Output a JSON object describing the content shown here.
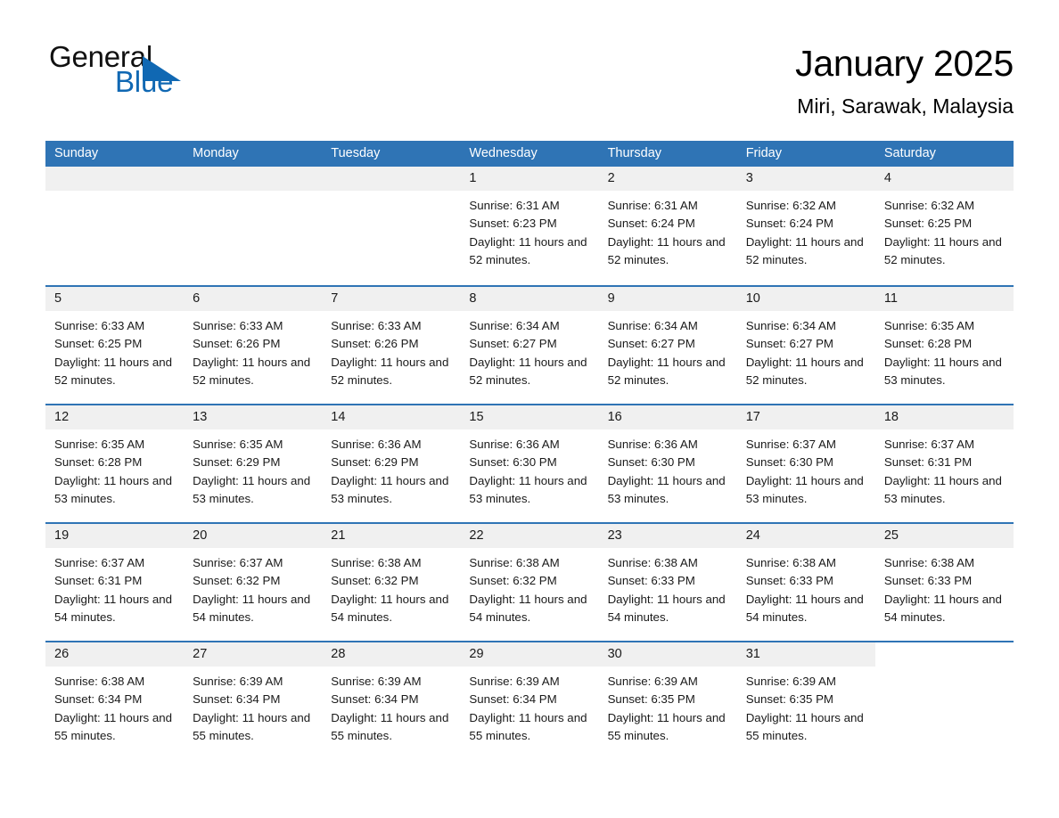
{
  "brand": {
    "word_one": "General",
    "word_two": "Blue",
    "triangle_color": "#1068b3"
  },
  "header": {
    "month_title": "January 2025",
    "location": "Miri, Sarawak, Malaysia"
  },
  "theme": {
    "header_blue": "#2f74b5",
    "day_band_gray": "#f0f0f0",
    "text_dark": "#1a1a1a",
    "header_text": "#ffffff"
  },
  "weekdays": [
    "Sunday",
    "Monday",
    "Tuesday",
    "Wednesday",
    "Thursday",
    "Friday",
    "Saturday"
  ],
  "weeks": [
    [
      {
        "day": "",
        "empty": true
      },
      {
        "day": "",
        "empty": true
      },
      {
        "day": "",
        "empty": true
      },
      {
        "day": "1",
        "sunrise": "Sunrise: 6:31 AM",
        "sunset": "Sunset: 6:23 PM",
        "daylight": "Daylight: 11 hours and 52 minutes."
      },
      {
        "day": "2",
        "sunrise": "Sunrise: 6:31 AM",
        "sunset": "Sunset: 6:24 PM",
        "daylight": "Daylight: 11 hours and 52 minutes."
      },
      {
        "day": "3",
        "sunrise": "Sunrise: 6:32 AM",
        "sunset": "Sunset: 6:24 PM",
        "daylight": "Daylight: 11 hours and 52 minutes."
      },
      {
        "day": "4",
        "sunrise": "Sunrise: 6:32 AM",
        "sunset": "Sunset: 6:25 PM",
        "daylight": "Daylight: 11 hours and 52 minutes."
      }
    ],
    [
      {
        "day": "5",
        "sunrise": "Sunrise: 6:33 AM",
        "sunset": "Sunset: 6:25 PM",
        "daylight": "Daylight: 11 hours and 52 minutes."
      },
      {
        "day": "6",
        "sunrise": "Sunrise: 6:33 AM",
        "sunset": "Sunset: 6:26 PM",
        "daylight": "Daylight: 11 hours and 52 minutes."
      },
      {
        "day": "7",
        "sunrise": "Sunrise: 6:33 AM",
        "sunset": "Sunset: 6:26 PM",
        "daylight": "Daylight: 11 hours and 52 minutes."
      },
      {
        "day": "8",
        "sunrise": "Sunrise: 6:34 AM",
        "sunset": "Sunset: 6:27 PM",
        "daylight": "Daylight: 11 hours and 52 minutes."
      },
      {
        "day": "9",
        "sunrise": "Sunrise: 6:34 AM",
        "sunset": "Sunset: 6:27 PM",
        "daylight": "Daylight: 11 hours and 52 minutes."
      },
      {
        "day": "10",
        "sunrise": "Sunrise: 6:34 AM",
        "sunset": "Sunset: 6:27 PM",
        "daylight": "Daylight: 11 hours and 52 minutes."
      },
      {
        "day": "11",
        "sunrise": "Sunrise: 6:35 AM",
        "sunset": "Sunset: 6:28 PM",
        "daylight": "Daylight: 11 hours and 53 minutes."
      }
    ],
    [
      {
        "day": "12",
        "sunrise": "Sunrise: 6:35 AM",
        "sunset": "Sunset: 6:28 PM",
        "daylight": "Daylight: 11 hours and 53 minutes."
      },
      {
        "day": "13",
        "sunrise": "Sunrise: 6:35 AM",
        "sunset": "Sunset: 6:29 PM",
        "daylight": "Daylight: 11 hours and 53 minutes."
      },
      {
        "day": "14",
        "sunrise": "Sunrise: 6:36 AM",
        "sunset": "Sunset: 6:29 PM",
        "daylight": "Daylight: 11 hours and 53 minutes."
      },
      {
        "day": "15",
        "sunrise": "Sunrise: 6:36 AM",
        "sunset": "Sunset: 6:30 PM",
        "daylight": "Daylight: 11 hours and 53 minutes."
      },
      {
        "day": "16",
        "sunrise": "Sunrise: 6:36 AM",
        "sunset": "Sunset: 6:30 PM",
        "daylight": "Daylight: 11 hours and 53 minutes."
      },
      {
        "day": "17",
        "sunrise": "Sunrise: 6:37 AM",
        "sunset": "Sunset: 6:30 PM",
        "daylight": "Daylight: 11 hours and 53 minutes."
      },
      {
        "day": "18",
        "sunrise": "Sunrise: 6:37 AM",
        "sunset": "Sunset: 6:31 PM",
        "daylight": "Daylight: 11 hours and 53 minutes."
      }
    ],
    [
      {
        "day": "19",
        "sunrise": "Sunrise: 6:37 AM",
        "sunset": "Sunset: 6:31 PM",
        "daylight": "Daylight: 11 hours and 54 minutes."
      },
      {
        "day": "20",
        "sunrise": "Sunrise: 6:37 AM",
        "sunset": "Sunset: 6:32 PM",
        "daylight": "Daylight: 11 hours and 54 minutes."
      },
      {
        "day": "21",
        "sunrise": "Sunrise: 6:38 AM",
        "sunset": "Sunset: 6:32 PM",
        "daylight": "Daylight: 11 hours and 54 minutes."
      },
      {
        "day": "22",
        "sunrise": "Sunrise: 6:38 AM",
        "sunset": "Sunset: 6:32 PM",
        "daylight": "Daylight: 11 hours and 54 minutes."
      },
      {
        "day": "23",
        "sunrise": "Sunrise: 6:38 AM",
        "sunset": "Sunset: 6:33 PM",
        "daylight": "Daylight: 11 hours and 54 minutes."
      },
      {
        "day": "24",
        "sunrise": "Sunrise: 6:38 AM",
        "sunset": "Sunset: 6:33 PM",
        "daylight": "Daylight: 11 hours and 54 minutes."
      },
      {
        "day": "25",
        "sunrise": "Sunrise: 6:38 AM",
        "sunset": "Sunset: 6:33 PM",
        "daylight": "Daylight: 11 hours and 54 minutes."
      }
    ],
    [
      {
        "day": "26",
        "sunrise": "Sunrise: 6:38 AM",
        "sunset": "Sunset: 6:34 PM",
        "daylight": "Daylight: 11 hours and 55 minutes."
      },
      {
        "day": "27",
        "sunrise": "Sunrise: 6:39 AM",
        "sunset": "Sunset: 6:34 PM",
        "daylight": "Daylight: 11 hours and 55 minutes."
      },
      {
        "day": "28",
        "sunrise": "Sunrise: 6:39 AM",
        "sunset": "Sunset: 6:34 PM",
        "daylight": "Daylight: 11 hours and 55 minutes."
      },
      {
        "day": "29",
        "sunrise": "Sunrise: 6:39 AM",
        "sunset": "Sunset: 6:34 PM",
        "daylight": "Daylight: 11 hours and 55 minutes."
      },
      {
        "day": "30",
        "sunrise": "Sunrise: 6:39 AM",
        "sunset": "Sunset: 6:35 PM",
        "daylight": "Daylight: 11 hours and 55 minutes."
      },
      {
        "day": "31",
        "sunrise": "Sunrise: 6:39 AM",
        "sunset": "Sunset: 6:35 PM",
        "daylight": "Daylight: 11 hours and 55 minutes."
      },
      {
        "day": "",
        "blank": true
      }
    ]
  ]
}
